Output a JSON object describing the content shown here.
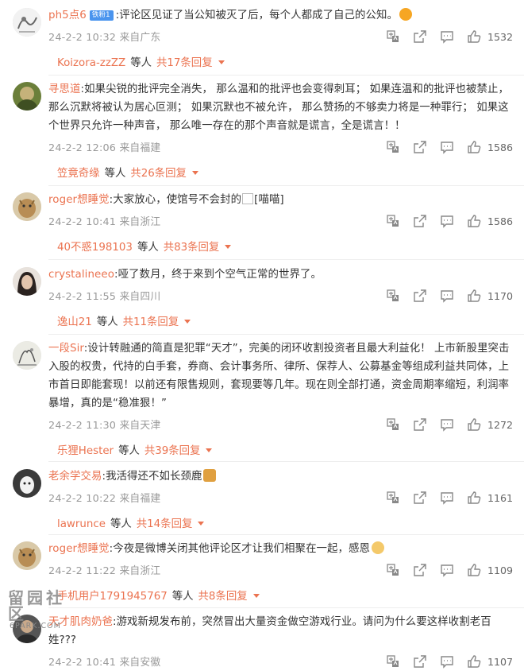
{
  "icons": {
    "translate": "translate-icon",
    "share": "share-icon",
    "comment": "comment-icon",
    "like": "thumbs-up-icon",
    "expand": "caret-down-icon"
  },
  "colors": {
    "username": "#eb7350",
    "meta": "#999999",
    "text": "#333333",
    "badge": "#4a94ee"
  },
  "comments": [
    {
      "user": "ph5点6",
      "badge": "铁粉1",
      "content": ":评论区见证了当公知被灭了后，每个人都成了自己的公知。",
      "emoji": "grin-emoji",
      "time": "24-2-2 10:32",
      "location": "来自广东",
      "likes": "1532",
      "reply_user": "Koizora-zzZZ",
      "reply_mid": "等人",
      "reply_count": "共17条回复"
    },
    {
      "user": "寻思道",
      "content": ":如果尖锐的批评完全消失，  那么温和的批评也会变得刺耳；  如果连温和的批评也被禁止，  那么沉默将被认为居心叵测；  如果沉默也不被允许，  那么赞扬的不够卖力将是一种罪行；  如果这个世界只允许一种声音，  那么唯一存在的那个声音就是谎言，全是谎言！！",
      "time": "24-2-2 12:06",
      "location": "来自福建",
      "likes": "1586",
      "reply_user": "笠竟奇缘",
      "reply_mid": "等人",
      "reply_count": "共26条回复"
    },
    {
      "user": "roger想睡觉",
      "content": ":大家放心，使馆号不会封的",
      "image_alt": "[喵喵]",
      "time": "24-2-2 10:41",
      "location": "来自浙江",
      "likes": "1586",
      "reply_user": "40不惑198103",
      "reply_mid": "等人",
      "reply_count": "共83条回复"
    },
    {
      "user": "crystalineeo",
      "content": ":哑了数月，终于来到个空气正常的世界了。",
      "time": "24-2-2 11:55",
      "location": "来自四川",
      "likes": "1170",
      "reply_user": "逸山21",
      "reply_mid": "等人",
      "reply_count": "共11条回复"
    },
    {
      "user": "一段Sir",
      "content": ":设计转融通的简直是犯罪“天才”，完美的闭环收割投资者且最大利益化！ 上市新股里突击入股的权贵，代持的白手套，券商、会计事务所、律所、保荐人、公募基金等组成利益共同体，上市首日即能套现！以前还有限售规则，套现要等几年。现在则全部打通，资金周期率缩短，利润率暴增，真的是“稳准狠！”",
      "time": "24-2-2 11:30",
      "location": "来自天津",
      "likes": "1272",
      "reply_user": "乐狸Hester",
      "reply_mid": "等人",
      "reply_count": "共39条回复"
    },
    {
      "user": "老余学交易",
      "content": ":我活得还不如长颈鹿",
      "emoji": "giraffe-emoji",
      "time": "24-2-2 10:22",
      "location": "来自福建",
      "likes": "1161",
      "reply_user": "lawrunce",
      "reply_mid": "等人",
      "reply_count": "共14条回复"
    },
    {
      "user": "roger想睡觉",
      "content": ":今夜是微博关闭其他评论区才让我们相聚在一起，感恩",
      "emoji": "grateful-emoji",
      "time": "24-2-2 11:22",
      "location": "来自浙江",
      "likes": "1109",
      "reply_user": "手机用户1791945767",
      "reply_mid": "等人",
      "reply_count": "共8条回复"
    },
    {
      "user": "天才肌肉奶爸",
      "content": ":游戏新规发布前，突然冒出大量资金做空游戏行业。请问为什么要这样收割老百姓???",
      "time": "24-2-2 10:41",
      "location": "来自安徽",
      "likes": "1107"
    }
  ],
  "watermark": {
    "top": "留园社区",
    "bottom": "6PARK.COM"
  }
}
